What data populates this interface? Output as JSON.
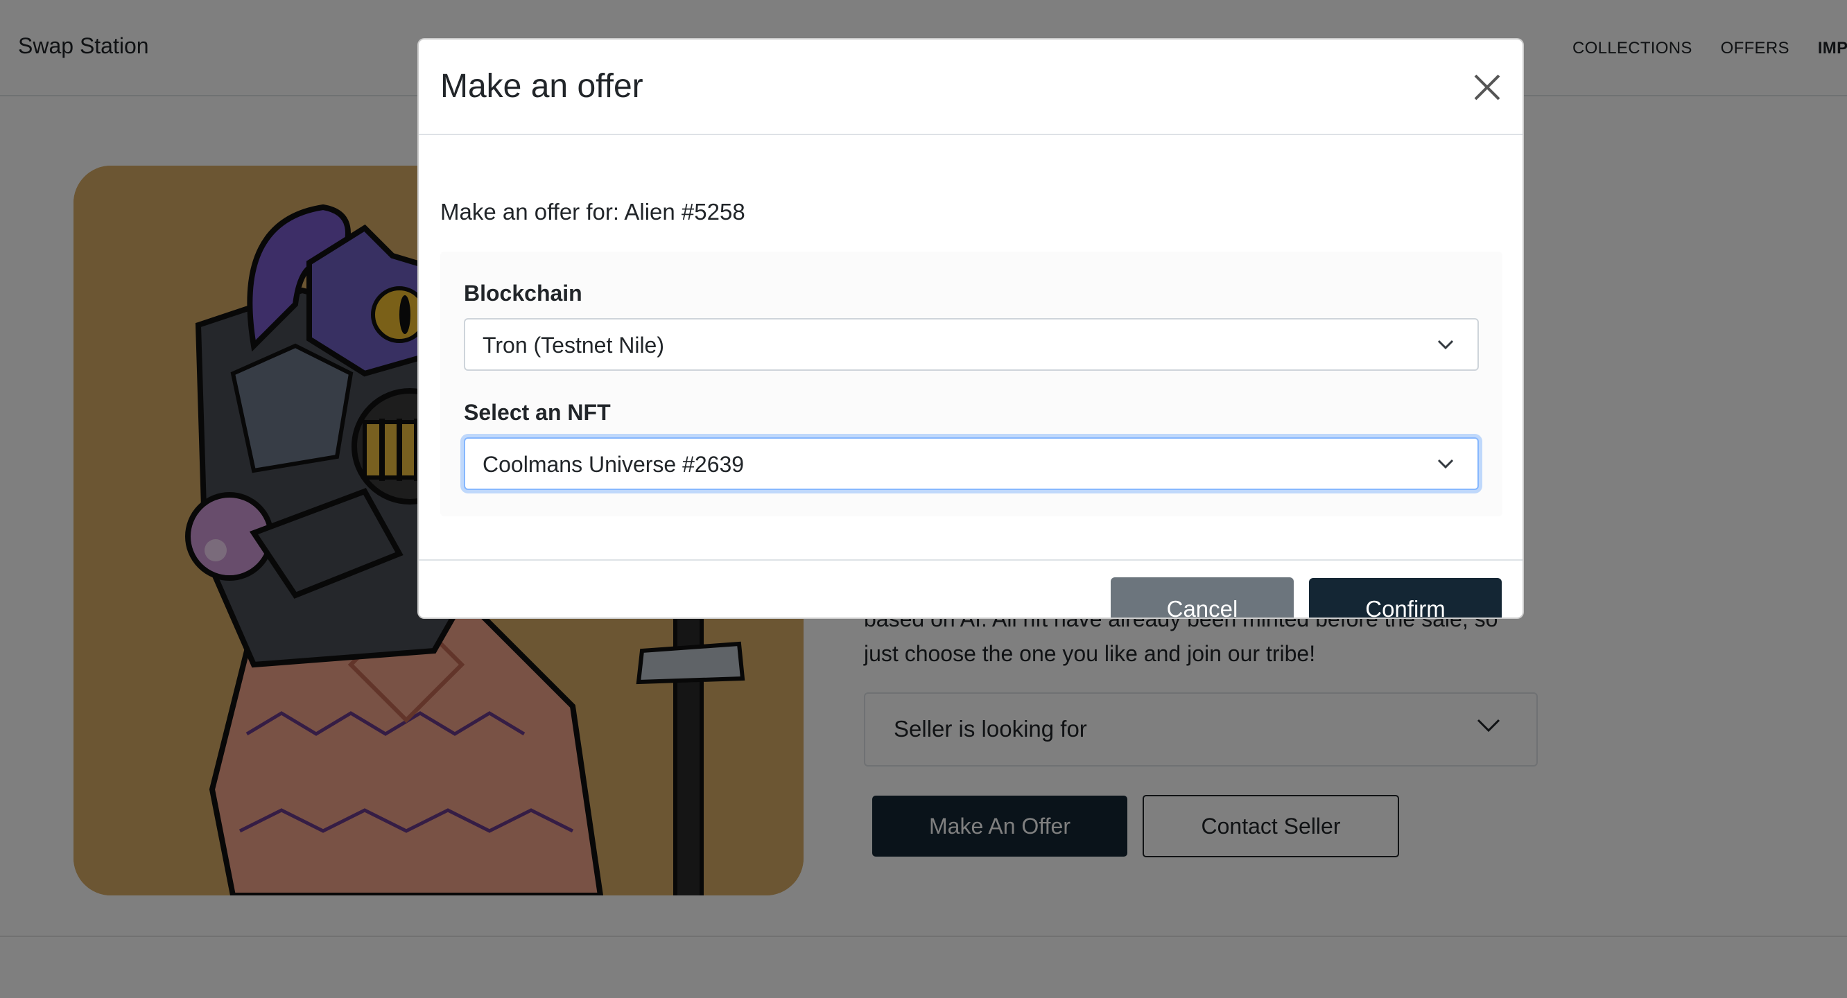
{
  "navbar": {
    "brand": "Swap Station",
    "links": [
      "COLLECTIONS",
      "OFFERS",
      "IMPO"
    ]
  },
  "page": {
    "description_line1": "based on AI. All nft have already been minted before the sale, so",
    "description_line2": "just choose the one you like and join our tribe!",
    "seller_accordion_label": "Seller is looking for",
    "make_offer_label": "Make An Offer",
    "contact_seller_label": "Contact Seller"
  },
  "modal": {
    "title": "Make an offer",
    "offer_for": "Make an offer for: Alien #5258",
    "blockchain_label": "Blockchain",
    "blockchain_value": "Tron (Testnet Nile)",
    "nft_label": "Select an NFT",
    "nft_value": "Coolmans Universe #2639",
    "cancel_label": "Cancel",
    "confirm_label": "Confirm"
  },
  "colors": {
    "primary_dark": "#142634",
    "secondary": "#6c757d",
    "focus_ring": "#86b7fe",
    "nft_background": "#d8ac66"
  },
  "icons": {
    "close": "close-icon",
    "select_chevron": "chevron-down-icon"
  }
}
